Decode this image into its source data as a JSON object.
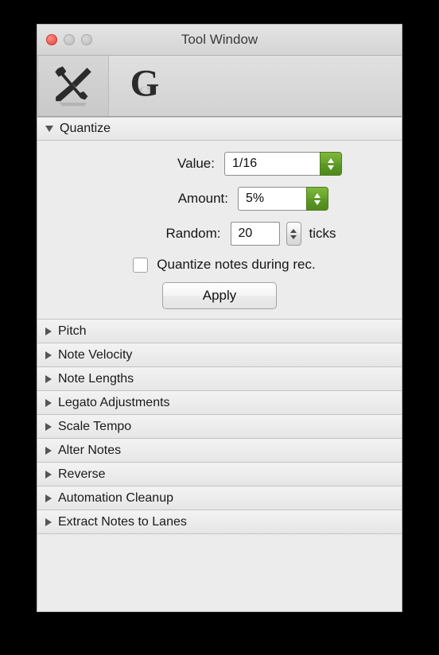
{
  "window": {
    "title": "Tool Window",
    "traffic_lights": [
      "close",
      "minimize",
      "maximize"
    ]
  },
  "toolbar": {
    "tabs": [
      {
        "icon": "tools-crossed-icon",
        "label": "",
        "selected": true
      },
      {
        "icon": "letter-g-icon",
        "label": "",
        "selected": false
      }
    ]
  },
  "quantize": {
    "header": "Quantize",
    "expanded": true,
    "value": {
      "label": "Value:",
      "value": "1/16"
    },
    "amount": {
      "label": "Amount:",
      "value": "5%"
    },
    "random": {
      "label": "Random:",
      "value": "20",
      "unit": "ticks"
    },
    "during_rec": {
      "label": "Quantize notes during rec.",
      "checked": false
    },
    "apply_label": "Apply"
  },
  "sections": [
    {
      "title": "Pitch",
      "expanded": false
    },
    {
      "title": "Note Velocity",
      "expanded": false
    },
    {
      "title": "Note Lengths",
      "expanded": false
    },
    {
      "title": "Legato Adjustments",
      "expanded": false
    },
    {
      "title": "Scale Tempo",
      "expanded": false
    },
    {
      "title": "Alter Notes",
      "expanded": false
    },
    {
      "title": "Reverse",
      "expanded": false
    },
    {
      "title": "Automation Cleanup",
      "expanded": false
    },
    {
      "title": "Extract Notes to Lanes",
      "expanded": false
    }
  ],
  "colors": {
    "accent_green": "#63a02a",
    "window_bg": "#ececec",
    "titlebar": "#d8d8d8",
    "close_red": "#e8453c"
  }
}
